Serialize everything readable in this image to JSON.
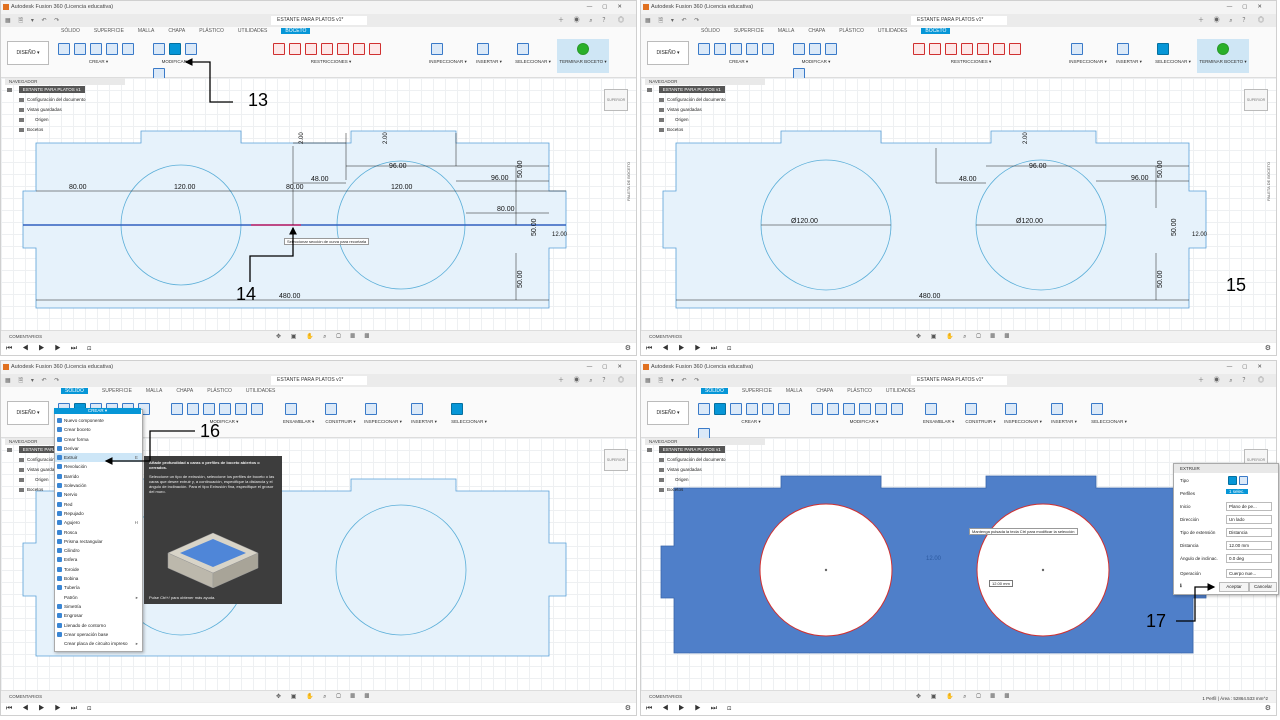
{
  "app": {
    "title": "Autodesk Fusion 360 (Licencia educativa)",
    "doc_name": "ESTANTE PARA PLATOS v1*",
    "design_button": "DISEÑO ▾",
    "tabs": [
      "SÓLIDO",
      "SUPERFICIE",
      "MALLA",
      "CHAPA",
      "PLÁSTICO",
      "UTILIDADES",
      "BOCETO"
    ],
    "sketch_groups": [
      "CREAR ▾",
      "MODIFICAR ▾",
      "RESTRICCIONES ▾",
      "INSPECCIONAR ▾",
      "INSERTAR ▾",
      "SELECCIONAR ▾",
      "TERMINAR BOCETO ▾"
    ],
    "solid_groups": [
      "CREAR ▾",
      "MODIFICAR ▾",
      "ENSAMBLAR ▾",
      "CONSTRUIR ▾",
      "INSPECCIONAR ▾",
      "INSERTAR ▾",
      "SELECCIONAR ▾"
    ],
    "navigator": {
      "header": "NAVEGADOR",
      "root": "ESTANTE PARA PLATOS v1",
      "items": [
        "Configuración del documento",
        "Vistas guardadas",
        "Origen",
        "Bocetos"
      ]
    },
    "comments": "COMENTARIOS",
    "viewcube": "SUPERIOR",
    "paleta": "PALETA DE BOCETO"
  },
  "callouts": [
    "13",
    "14",
    "15",
    "16",
    "17"
  ],
  "dimensions": {
    "p1": [
      "2.00",
      "80.00",
      "120.00",
      "80.00",
      "48.00",
      "96.00",
      "120.00",
      "96.00",
      "50.00",
      "80.00",
      "50.00",
      "2.00",
      "50.00",
      "480.00",
      "12.00"
    ],
    "p2": [
      "2.00",
      "96.00",
      "48.00",
      "96.00",
      "50.00",
      "Ø120.00",
      "Ø120.00",
      "12.00",
      "50.00",
      "50.00",
      "480.00"
    ]
  },
  "trim_tooltip": "Seleccionar sección de curva para recortarla",
  "crear_menu": {
    "label": "CREAR ▾",
    "items": [
      {
        "label": "Nuevo componente",
        "shortcut": ""
      },
      {
        "label": "Crear boceto",
        "shortcut": ""
      },
      {
        "label": "Crear forma",
        "shortcut": ""
      },
      {
        "label": "Derivar",
        "shortcut": ""
      },
      {
        "label": "Extruir",
        "shortcut": "E"
      },
      {
        "label": "Revolución",
        "shortcut": ""
      },
      {
        "label": "Barrido",
        "shortcut": ""
      },
      {
        "label": "Solevación",
        "shortcut": ""
      },
      {
        "label": "Nervio",
        "shortcut": ""
      },
      {
        "label": "Red",
        "shortcut": ""
      },
      {
        "label": "Repujado",
        "shortcut": ""
      },
      {
        "label": "Agujero",
        "shortcut": "H"
      },
      {
        "label": "Rosca",
        "shortcut": ""
      },
      {
        "label": "Prisma rectangular",
        "shortcut": ""
      },
      {
        "label": "Cilindro",
        "shortcut": ""
      },
      {
        "label": "Esfera",
        "shortcut": ""
      },
      {
        "label": "Toroide",
        "shortcut": ""
      },
      {
        "label": "Bobina",
        "shortcut": ""
      },
      {
        "label": "Tubería",
        "shortcut": ""
      },
      {
        "label": "Patrón",
        "shortcut": "▸"
      },
      {
        "label": "Simetría",
        "shortcut": ""
      },
      {
        "label": "Engrosar",
        "shortcut": ""
      },
      {
        "label": "Llenado de contorno",
        "shortcut": ""
      },
      {
        "label": "Crear operación base",
        "shortcut": ""
      },
      {
        "label": "Crear placa de circuito impreso",
        "shortcut": "▸"
      }
    ]
  },
  "extrude_tooltip": {
    "title": "Añade profundidad a caras o perfiles de boceto abiertos o cerrados.",
    "body": "Seleccione un tipo de extrusión, seleccione los perfiles de boceto o las caras que desee extruir y, a continuación, especifique la distancia y el ángulo de inclinación. Para el tipo Extrusión fina, especifique el grosor del muro.",
    "hint": "Pulse Ctrl+/ para obtener más ayuda."
  },
  "extrude_dialog": {
    "title": "EXTRUIR",
    "rows": [
      {
        "label": "Tipo",
        "value": ""
      },
      {
        "label": "Perfiles",
        "value": "1 selec."
      },
      {
        "label": "Inicio",
        "value": "Plano de pe..."
      },
      {
        "label": "Dirección",
        "value": "Un lado"
      },
      {
        "label": "Tipo de extensión",
        "value": "Distancia"
      },
      {
        "label": "Distancia",
        "value": "12.00 mm"
      },
      {
        "label": "Ángulo de inclinac.",
        "value": "0.0 deg"
      },
      {
        "label": "Operación",
        "value": "Cuerpo nue..."
      }
    ],
    "ok": "Aceptar",
    "cancel": "Cancelar"
  },
  "ctrl_tip": "Mantenga pulsada la tecla Ctrl para modificar la selección",
  "distance_input": "12.00 mm",
  "distance_label": "12.00",
  "status": "1 Perfil | Área : 52864.533 mm^2"
}
